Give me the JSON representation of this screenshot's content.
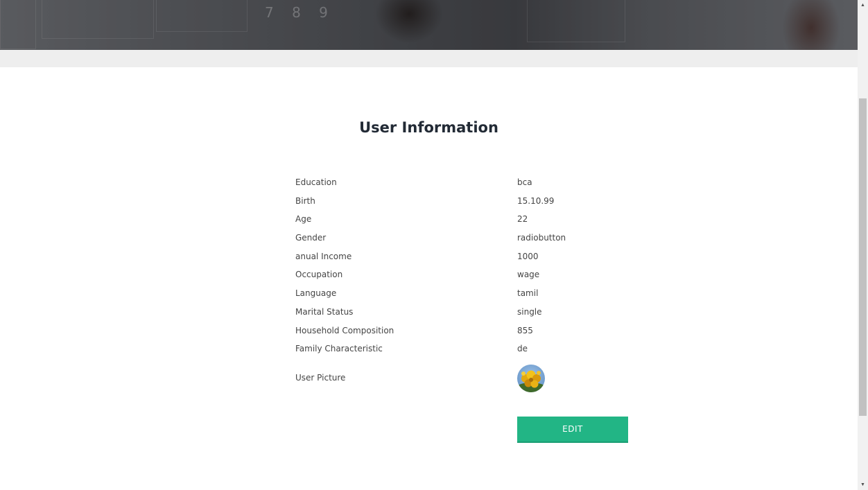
{
  "page": {
    "title": "User Information",
    "accent_color": "#22b585"
  },
  "hero": {
    "digits_text": "7 8 9"
  },
  "user_info": {
    "rows": [
      {
        "label": "Education",
        "value": "bca"
      },
      {
        "label": "Birth",
        "value": "15.10.99"
      },
      {
        "label": "Age",
        "value": "22"
      },
      {
        "label": "Gender",
        "value": "radiobutton"
      },
      {
        "label": "anual Income",
        "value": "1000"
      },
      {
        "label": "Occupation",
        "value": "wage"
      },
      {
        "label": "Language",
        "value": "tamil"
      },
      {
        "label": "Marital Status",
        "value": "single"
      },
      {
        "label": "Household Composition",
        "value": "855"
      },
      {
        "label": "Family Characteristic",
        "value": "de"
      }
    ],
    "picture_label": "User Picture",
    "picture_icon": "yellow-flowers-avatar"
  },
  "actions": {
    "edit_label": "EDIT"
  },
  "scrollbar": {
    "up_icon": "▲",
    "down_icon": "▼"
  }
}
